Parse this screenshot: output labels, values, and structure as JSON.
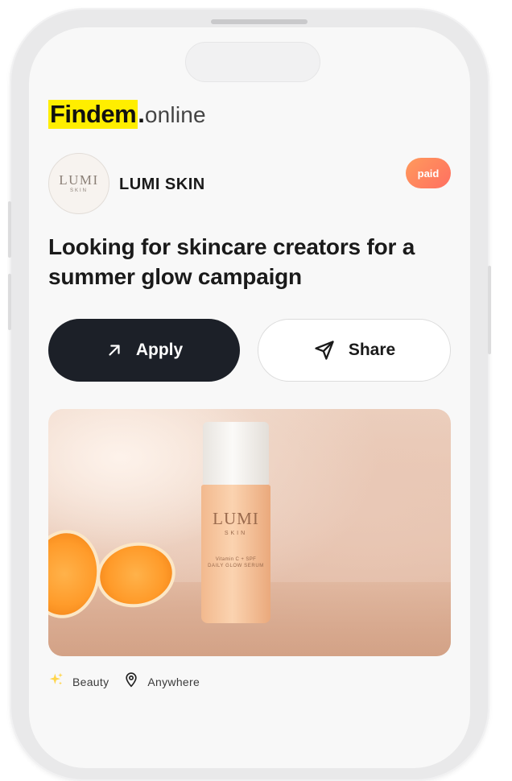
{
  "brand": {
    "main": "Findem",
    "dot": ".",
    "sub": "online"
  },
  "company": {
    "logo_word": "LUMI",
    "logo_sub": "SKIN",
    "name": "LUMI SKIN"
  },
  "badge": {
    "label": "paid"
  },
  "headline": "Looking for skincare creators for a summer glow campaign",
  "actions": {
    "apply_label": "Apply",
    "share_label": "Share"
  },
  "product": {
    "brand": "LUMI",
    "sub": "SKIN",
    "line1": "Vitamin C + SPF",
    "line2": "DAILY GLOW SERUM"
  },
  "meta": {
    "category": "Beauty",
    "location": "Anywhere"
  },
  "colors": {
    "brand_highlight": "#ffee00",
    "apply_bg": "#1c2028",
    "badge_gradient_start": "#ff9a5c",
    "badge_gradient_end": "#ff6f61"
  },
  "icons": {
    "apply": "arrow-up-right-icon",
    "share": "send-icon",
    "category": "sparkles-icon",
    "location": "map-pin-icon"
  }
}
